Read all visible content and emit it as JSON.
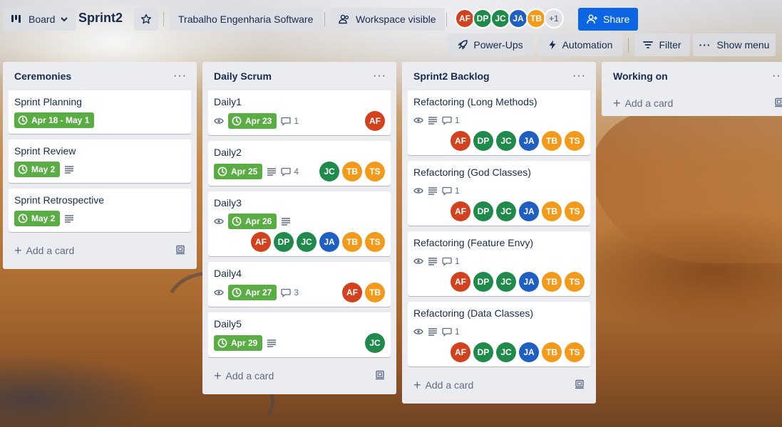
{
  "header": {
    "view_label": "Board",
    "board_title": "Sprint2",
    "workspace_name": "Trabalho Engenharia Software",
    "visibility_label": "Workspace visible",
    "members": [
      {
        "initials": "AF",
        "color": "#d2421f"
      },
      {
        "initials": "DP",
        "color": "#1f8a4c"
      },
      {
        "initials": "JC",
        "color": "#1f8a4c"
      },
      {
        "initials": "JA",
        "color": "#1f5fc2"
      },
      {
        "initials": "TB",
        "color": "#f29a1b"
      }
    ],
    "more_members": "+1",
    "share_label": "Share",
    "powerups_label": "Power-Ups",
    "automation_label": "Automation",
    "filter_label": "Filter",
    "show_menu_label": "Show menu"
  },
  "colors": {
    "AF": "#d2421f",
    "DP": "#1f8a4c",
    "JC": "#1f8a4c",
    "JA": "#1f5fc2",
    "TB": "#f29a1b",
    "TS": "#f29a1b",
    "date_green": "#5aac44",
    "share_blue": "#0c66e4"
  },
  "add_card_label": "Add a card",
  "lists": [
    {
      "title": "Ceremonies",
      "cards": [
        {
          "title": "Sprint Planning",
          "date": "Apr 18 - May 1"
        },
        {
          "title": "Sprint Review",
          "date": "May 2",
          "description": true
        },
        {
          "title": "Sprint Retrospective",
          "date": "May 2",
          "description": true
        }
      ]
    },
    {
      "title": "Daily Scrum",
      "cards": [
        {
          "title": "Daily1",
          "watch": true,
          "date": "Apr 23",
          "comments": "1",
          "members": [
            "AF"
          ]
        },
        {
          "title": "Daily2",
          "date": "Apr 25",
          "description": true,
          "comments": "4",
          "members": [
            "JC",
            "TB",
            "TS"
          ]
        },
        {
          "title": "Daily3",
          "watch": true,
          "date": "Apr 26",
          "description": true,
          "members": [
            "AF",
            "DP",
            "JC",
            "JA",
            "TB",
            "TS"
          ]
        },
        {
          "title": "Daily4",
          "watch": true,
          "date": "Apr 27",
          "comments": "3",
          "members": [
            "AF",
            "TB"
          ]
        },
        {
          "title": "Daily5",
          "date": "Apr 29",
          "description": true,
          "members": [
            "JC"
          ]
        }
      ]
    },
    {
      "title": "Sprint2 Backlog",
      "cards": [
        {
          "title": "Refactoring (Long Methods)",
          "watch": true,
          "description": true,
          "comments": "1",
          "members": [
            "AF",
            "DP",
            "JC",
            "JA",
            "TB",
            "TS"
          ]
        },
        {
          "title": "Refactoring (God Classes)",
          "watch": true,
          "description": true,
          "comments": "1",
          "members": [
            "AF",
            "DP",
            "JC",
            "JA",
            "TB",
            "TS"
          ]
        },
        {
          "title": "Refactoring (Feature Envy)",
          "watch": true,
          "description": true,
          "comments": "1",
          "members": [
            "AF",
            "DP",
            "JC",
            "JA",
            "TB",
            "TS"
          ]
        },
        {
          "title": "Refactoring (Data Classes)",
          "watch": true,
          "description": true,
          "comments": "1",
          "members": [
            "AF",
            "DP",
            "JC",
            "JA",
            "TB",
            "TS"
          ]
        }
      ]
    },
    {
      "title": "Working on",
      "cards": []
    }
  ]
}
